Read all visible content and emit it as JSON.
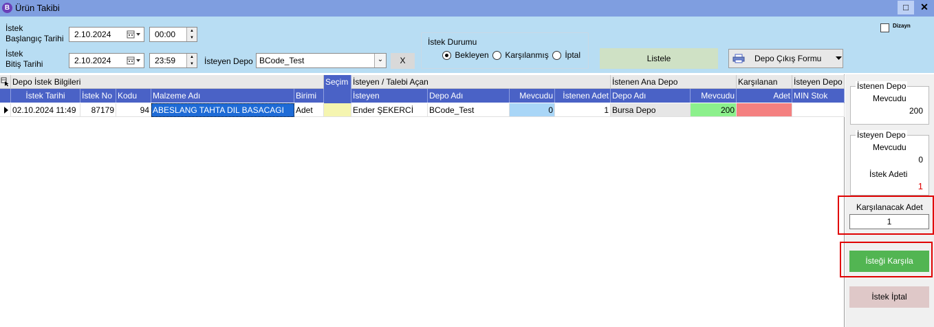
{
  "window": {
    "logo_letter": "B",
    "title": "Ürün Takibi",
    "maximize_glyph": "□",
    "close_glyph": "✕"
  },
  "filters": {
    "istek_label_1": "İstek",
    "baslangic_label": "Başlangıç Tarihi",
    "istek_label_2": "İstek",
    "bitis_label": "Bitiş Tarihi",
    "start_date": "2.10.2024",
    "start_time": "00:00",
    "end_date": "2.10.2024",
    "end_time": "23:59",
    "depo_label": "İsteyen Depo",
    "depo_value": "BCode_Test",
    "clear_label": "X",
    "status_title": "İstek Durumu",
    "status_options": [
      "Bekleyen",
      "Karşılanmış",
      "İptal"
    ],
    "status_selected": "Bekleyen",
    "listele_label": "Listele",
    "form_label": "Depo Çıkış Formu",
    "dizayn_label": "Dizayn"
  },
  "grid": {
    "bands": {
      "depo_istek": "Depo İstek Bilgileri",
      "secim": "Seçim",
      "isteyen": "İsteyen / Talebi Açan",
      "istenen": "İstenen Ana Depo",
      "karsilanan": "Karşılanan",
      "isteyen_depo": "İsteyen Depo"
    },
    "columns": [
      "İstek Tarihi",
      "İstek No",
      "Kodu",
      "Malzeme Adı",
      "Birimi",
      "İsteyen",
      "Depo Adı",
      "Mevcudu",
      "İstenen Adet",
      "Depo Adı",
      "Mevcudu",
      "Adet",
      "MIN Stok"
    ],
    "rows": [
      {
        "tarih": "02.10.2024 11:49",
        "istek_no": "87179",
        "kodu": "94",
        "malzeme": "ABESLANG TAHTA DIL BASACAGI",
        "birimi": "Adet",
        "isteyen": "Ender ŞEKERCİ",
        "depo": "BCode_Test",
        "mevcudu": "0",
        "istenen_adet": "1",
        "ana_depo": "Bursa Depo",
        "ana_mevcudu": "200",
        "adet": "",
        "min_stok": ""
      }
    ]
  },
  "side": {
    "istenen_title": "İstenen Depo",
    "istenen_mevcudu_label": "Mevcudu",
    "istenen_mevcudu": "200",
    "isteyen_title": "İsteyen Depo",
    "isteyen_mevcudu_label": "Mevcudu",
    "isteyen_mevcudu": "0",
    "istek_adeti_label": "İstek Adeti",
    "istek_adeti": "1",
    "karsilanacak_label": "Karşılanacak Adet",
    "karsilanacak_value": "1",
    "karsila_btn": "İsteği Karşıla",
    "iptal_btn": "İstek İptal"
  },
  "colors": {
    "title_bar": "#7f9ee0",
    "filter_bg": "#b8ddf3",
    "header_blue": "#4a62c6",
    "mevcudu_blue": "#a9d6f7",
    "ana_mevcudu_green": "#8cf08c",
    "adet_red": "#f48080",
    "secim_yellow": "#f5f5b0",
    "karsila_green": "#52b552",
    "iptal_pink": "#dfc8c8",
    "highlight_red": "#e00000"
  }
}
